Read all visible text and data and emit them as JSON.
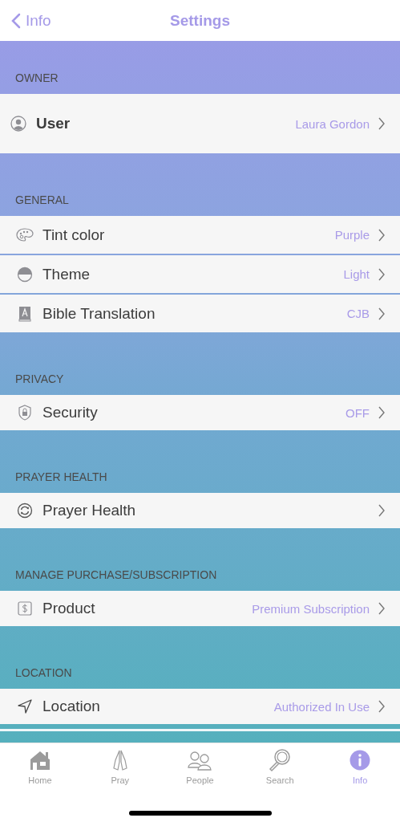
{
  "nav": {
    "back_label": "Info",
    "title": "Settings"
  },
  "sections": [
    {
      "header": "OWNER",
      "rows": [
        {
          "kind": "profile",
          "label": "User",
          "value": "Laura Gordon"
        }
      ]
    },
    {
      "header": "GENERAL",
      "rows": [
        {
          "kind": "standard",
          "label": "Tint color",
          "value": "Purple"
        },
        {
          "kind": "standard",
          "label": "Theme",
          "value": "Light"
        },
        {
          "kind": "standard",
          "label": "Bible Translation",
          "value": "CJB"
        }
      ]
    },
    {
      "header": "PRIVACY",
      "rows": [
        {
          "kind": "standard",
          "label": "Security",
          "value": "OFF"
        }
      ]
    },
    {
      "header": "PRAYER HEALTH",
      "rows": [
        {
          "kind": "standard",
          "label": "Prayer Health"
        }
      ]
    },
    {
      "header": "MANAGE PURCHASE/SUBSCRIPTION",
      "rows": [
        {
          "kind": "standard",
          "label": "Product",
          "value": "Premium Subscription"
        }
      ]
    },
    {
      "header": "LOCATION",
      "rows": [
        {
          "kind": "standard",
          "label": "Location",
          "value": "Authorized In Use"
        }
      ]
    }
  ],
  "tabs": [
    {
      "label": "Home",
      "selected": false
    },
    {
      "label": "Pray",
      "selected": false
    },
    {
      "label": "People",
      "selected": false
    },
    {
      "label": "Search",
      "selected": false
    },
    {
      "label": "Info",
      "selected": true
    }
  ]
}
